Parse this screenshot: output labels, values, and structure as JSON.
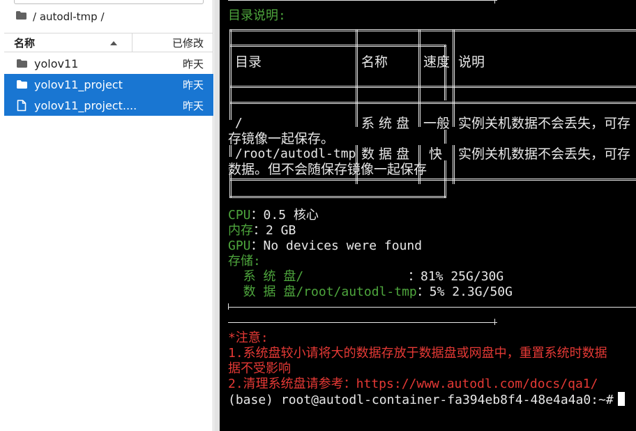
{
  "browser": {
    "breadcrumb": "/ autodl-tmp /",
    "columns": {
      "name": "名称",
      "modified": "已修改"
    },
    "items": [
      {
        "name": "yolov11",
        "modified": "昨天",
        "icon": "folder-icon",
        "selected": false
      },
      {
        "name": "yolov11_project",
        "modified": "昨天",
        "icon": "folder-icon",
        "selected": true
      },
      {
        "name": "yolov11_project....",
        "modified": "昨天",
        "icon": "file-icon",
        "selected": true
      }
    ]
  },
  "terminal": {
    "heading": "目录说明:",
    "table": {
      "headers": [
        "目录",
        "名称",
        "速度",
        "说明"
      ],
      "rows": [
        {
          "dir": "/",
          "name": "系 统 盘",
          "speed": "一般",
          "desc": "实例关机数据不会丢失，可存",
          "wrap": "存镜像一起保存。"
        },
        {
          "dir": "/root/autodl-tmp",
          "name": "数 据 盘",
          "speed": "快",
          "desc": "实例关机数据不会丢失，可存",
          "wrap": "数据。但不会随保存镜像一起保存"
        }
      ]
    },
    "cpu_label": "CPU",
    "cpu_value": "：0.5 核心",
    "mem_label": "内存",
    "mem_value": "：2 GB",
    "gpu_label": "GPU",
    "gpu_value": "：No devices were found",
    "storage_label": "存储:",
    "sys_disk_label": "  系 统 盘/",
    "sys_disk_value": "：81% 25G/30G",
    "data_disk_label": "  数 据 盘/root/autodl-tmp",
    "data_disk_value": "：5% 2.3G/50G",
    "notice_title": "*注意:",
    "notice_1a": "1.系统盘较小请将大的数据存放于数据盘或网盘中，重置系统时数据",
    "notice_1b": "据不受影响",
    "notice_2": "2.清理系统盘请参考：https://www.autodl.com/docs/qa1/",
    "prompt": "(base) root@autodl-container-fa394eb8f4-48e4a4a0:~#"
  },
  "colors": {
    "accent": "#1976d2",
    "terminal_green": "#4ea63d",
    "terminal_red": "#e53935"
  }
}
